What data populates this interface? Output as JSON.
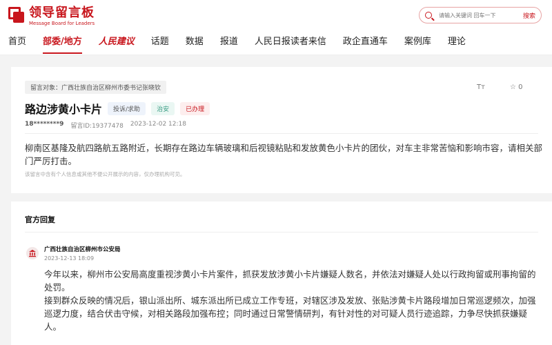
{
  "header": {
    "logo_title": "领导留言板",
    "logo_subtitle": "Message Board for Leaders",
    "search_placeholder": "请输入关键词 回车一下",
    "search_button": "搜索"
  },
  "nav": {
    "items": [
      "首页",
      "部委/地方",
      "人民建议",
      "话题",
      "数据",
      "报道",
      "人民日报读者来信",
      "政企直通车",
      "案例库",
      "理论"
    ],
    "active_index": 1,
    "brand_index": 2
  },
  "message": {
    "target": "留言对象：广西壮族自治区柳州市委书记张晓钦",
    "font_size_label": "Tт",
    "fav_label": "☆ 0",
    "title": "路边涉黄小卡片",
    "tags": [
      "投诉/求助",
      "治安",
      "已办理"
    ],
    "user": "18********9",
    "message_id": "留言ID:19377478",
    "time": "2023-12-02 12:18",
    "content": "柳南区基隆及航四路航五路附近，长期存在路边车辆玻璃和后视镜粘贴和发放黄色小卡片的团伙，对车主非常苦恼和影响市容，请相关部门严厉打击。",
    "note": "该留言中含有个人信息或其他不便公开展示的内容，仅办理机构可见。"
  },
  "reply": {
    "section_title": "官方回复",
    "org": "广西壮族自治区柳州市公安局",
    "date": "2023-12-13 18:09",
    "paragraph1": "今年以来，柳州市公安局高度重视涉黄小卡片案件，抓获发放涉黄小卡片嫌疑人数名，并依法对嫌疑人处以行政拘留或刑事拘留的处罚。",
    "paragraph2": "接到群众反映的情况后，银山派出所、城东派出所已成立工作专班，对辖区涉及发放、张贴涉黄卡片路段增加日常巡逻频次，加强巡逻力度，结合伏击守候，对相关路段加强布控；同时通过日常警情研判，有针对性的对可疑人员行迹追踪，力争尽快抓获嫌疑人。"
  },
  "colors": {
    "brand": "#c8161d"
  }
}
